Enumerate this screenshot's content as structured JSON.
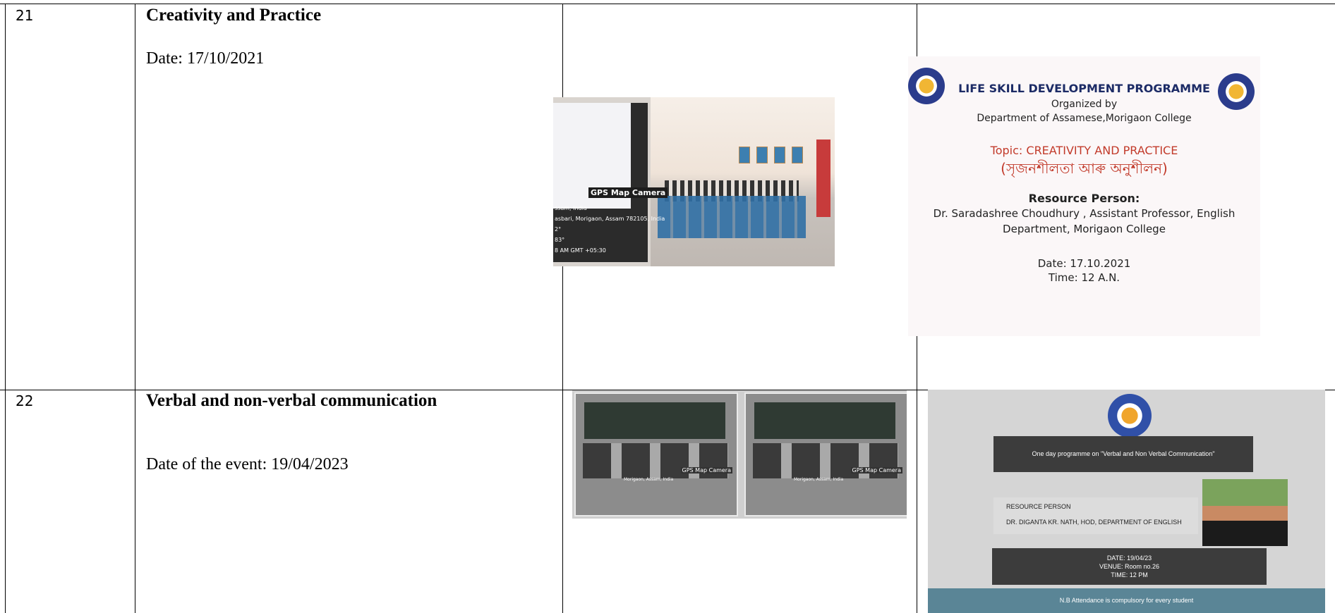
{
  "rows": [
    {
      "number": "21",
      "title": "Creativity and Practice",
      "date": "Date: 17/10/2021",
      "photo": {
        "overlay_tag": "GPS Map Camera",
        "overlay_lines": [
          "ssam, India",
          "asbari, Morigaon, Assam 782105, India",
          "2°",
          "83°",
          "8 AM GMT +05:30"
        ]
      },
      "poster": {
        "title": "LIFE SKILL DEVELOPMENT PROGRAMME",
        "organized": "Organized by",
        "department": "Department of Assamese,Morigaon College",
        "topic": "Topic: CREATIVITY AND PRACTICE",
        "topic_bengali": "(সৃজনশীলতা আৰু অনুশীলন)",
        "resource_heading": "Resource Person:",
        "resource_line1": "Dr. Saradashree Choudhury , Assistant Professor, English",
        "resource_line2": "Department, Morigaon College",
        "date": "Date: 17.10.2021",
        "time": "Time: 12 A.N."
      }
    },
    {
      "number": "22",
      "title": "Verbal and non-verbal communication",
      "date": "Date of the event: 19/04/2023",
      "photo": {
        "overlay_tag": "GPS Map Camera",
        "overlay_lines": [
          "Morigaon, Assam, India"
        ]
      },
      "poster": {
        "banner": "One day programme on \"Verbal and Non Verbal Communication\"",
        "resource_label": "RESOURCE PERSON",
        "resource_name": "DR. DIGANTA KR. NATH, HOD, DEPARTMENT OF ENGLISH",
        "date": "DATE: 19/04/23",
        "venue": "VENUE: Room no.26",
        "time": "TIME: 12 PM",
        "footer": "N.B Attendance is compulsory for every student"
      }
    }
  ]
}
